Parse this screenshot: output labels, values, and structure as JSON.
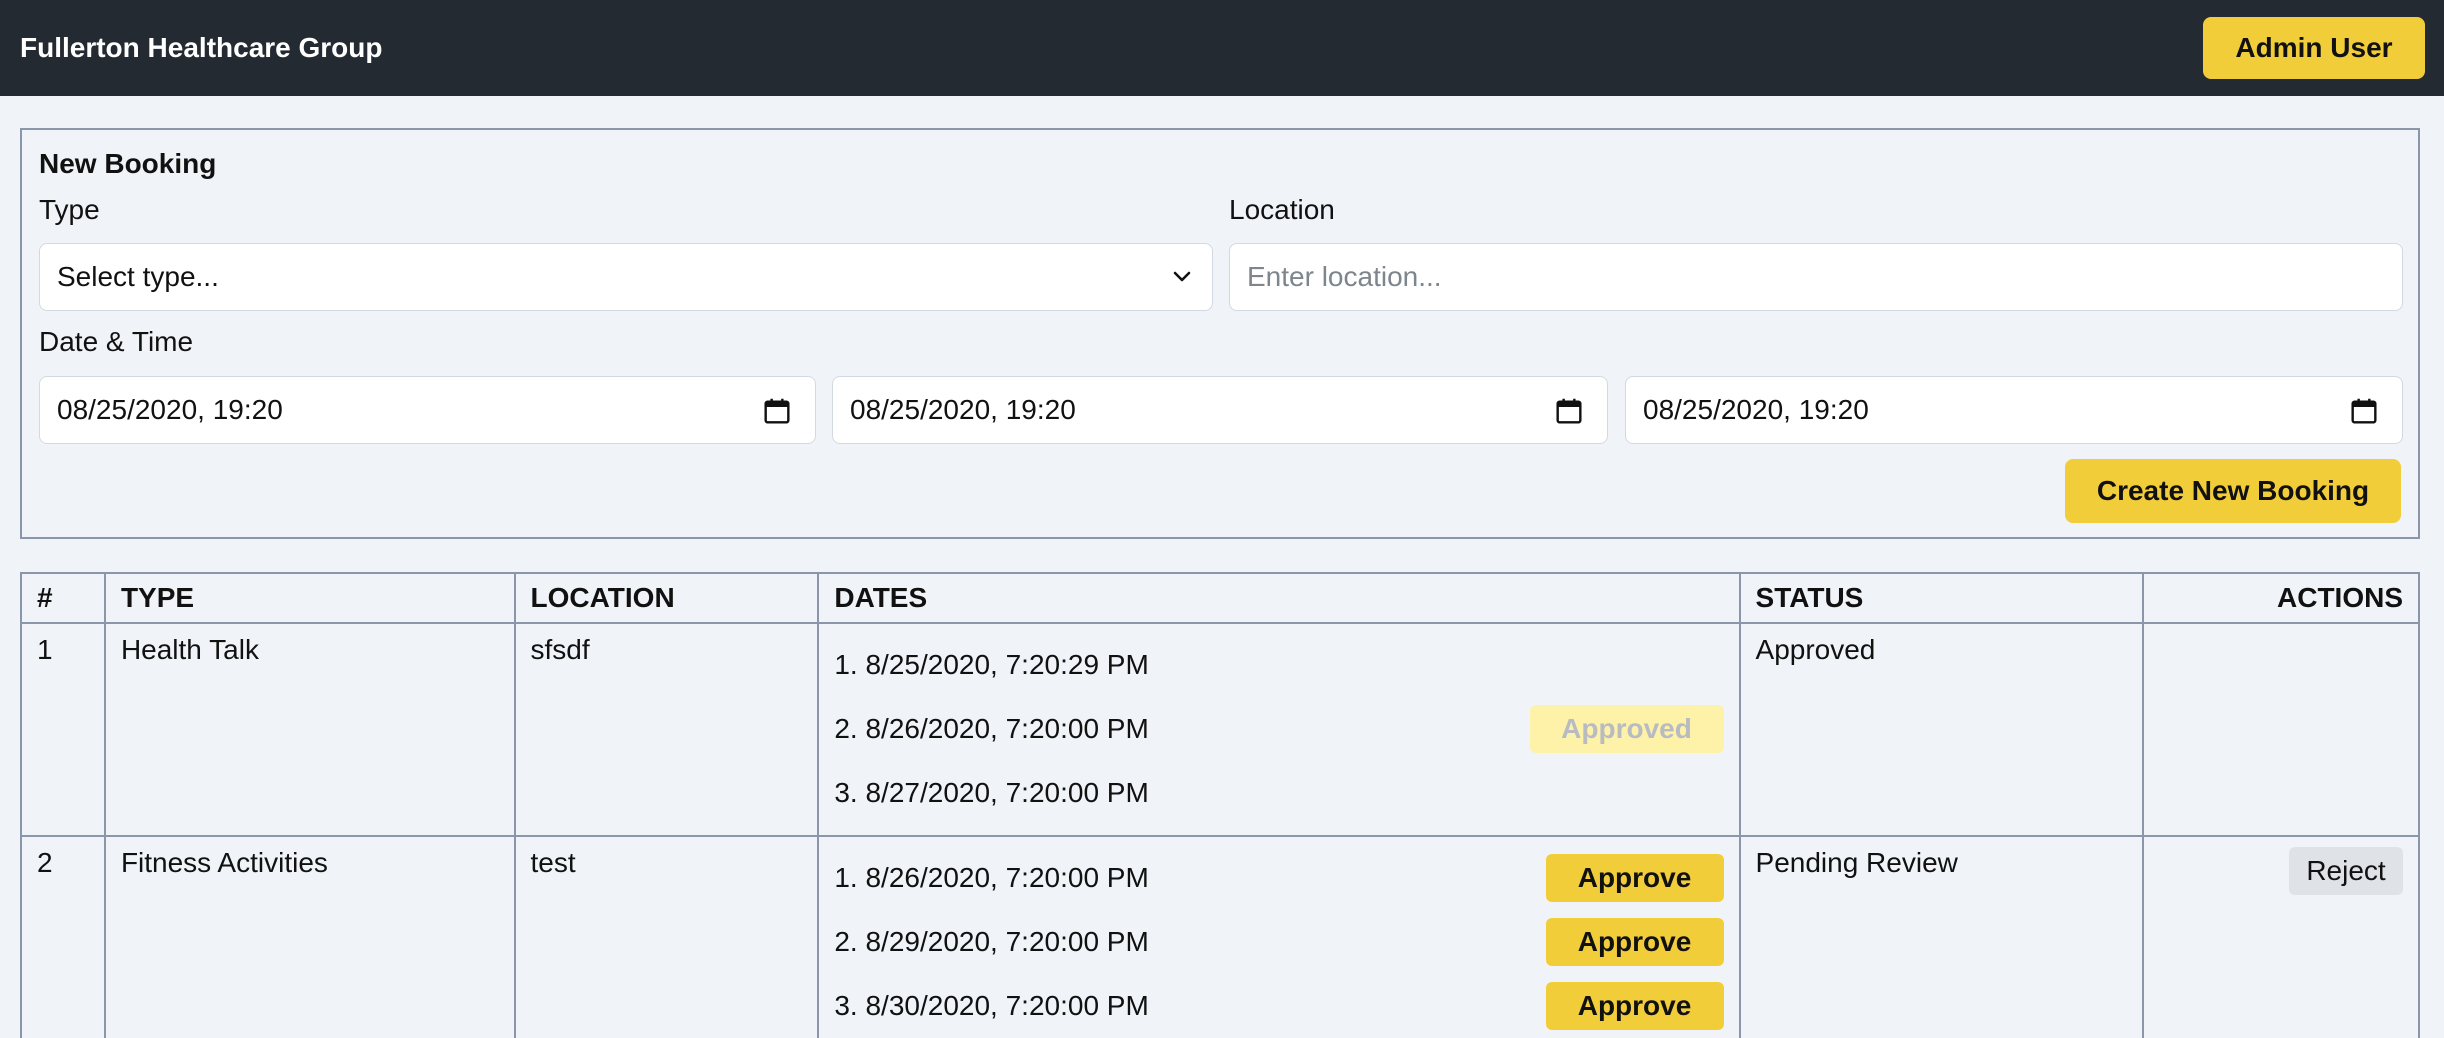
{
  "header": {
    "org_name": "Fullerton Healthcare Group",
    "user_label": "Admin User"
  },
  "booking_form": {
    "title": "New Booking",
    "type_label": "Type",
    "type_value": "Select type...",
    "location_label": "Location",
    "location_placeholder": "Enter location...",
    "datetime_label": "Date & Time",
    "datetime_values": [
      "08/25/2020, 19:20",
      "08/25/2020, 19:20",
      "08/25/2020, 19:20"
    ],
    "submit_label": "Create New Booking"
  },
  "table": {
    "columns": [
      "#",
      "TYPE",
      "LOCATION",
      "DATES",
      "STATUS",
      "ACTIONS"
    ],
    "rows": [
      {
        "index": "1",
        "type": "Health Talk",
        "location": "sfsdf",
        "dates": [
          {
            "text": "1. 8/25/2020, 7:20:29 PM",
            "action": ""
          },
          {
            "text": "2. 8/26/2020, 7:20:00 PM",
            "action": "Approved"
          },
          {
            "text": "3. 8/27/2020, 7:20:00 PM",
            "action": ""
          }
        ],
        "status": "Approved",
        "reject_label": ""
      },
      {
        "index": "2",
        "type": "Fitness Activities",
        "location": "test",
        "dates": [
          {
            "text": "1. 8/26/2020, 7:20:00 PM",
            "action": "Approve"
          },
          {
            "text": "2. 8/29/2020, 7:20:00 PM",
            "action": "Approve"
          },
          {
            "text": "3. 8/30/2020, 7:20:00 PM",
            "action": "Approve"
          }
        ],
        "status": "Pending Review",
        "reject_label": "Reject"
      }
    ]
  },
  "colors": {
    "header_bg": "#232a31",
    "accent": "#f2cd3a",
    "disabled_accent": "#fdf2a8",
    "page_bg": "#f0f4f8",
    "border": "#8a97aa"
  },
  "icons": {
    "select_chevron": "chevron-down-icon",
    "date_picker": "calendar-icon"
  }
}
